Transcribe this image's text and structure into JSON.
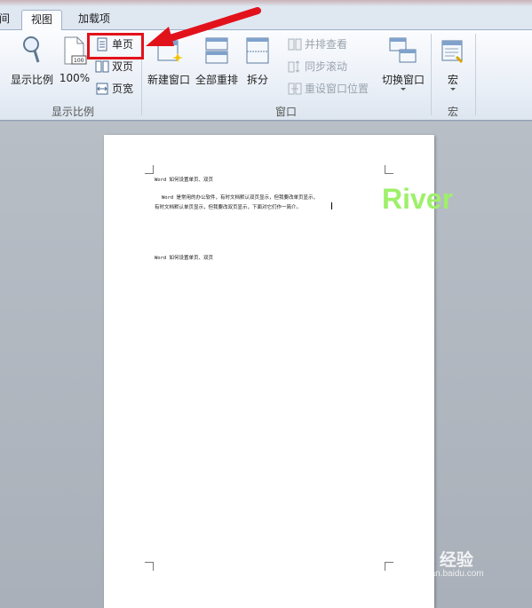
{
  "tabs": {
    "partial": "间",
    "view": "视图",
    "addins": "加载项"
  },
  "zoom_group": {
    "zoom_label": "显示比例",
    "hundred_label": "100%",
    "one_page_label": "单页",
    "two_pages_label": "双页",
    "page_width_label": "页宽",
    "group_label": "显示比例"
  },
  "window_group": {
    "new_window_label": "新建窗口",
    "arrange_all_label": "全部重排",
    "split_label": "拆分",
    "side_by_side_label": "并排查看",
    "sync_scroll_label": "同步滚动",
    "reset_position_label": "重设窗口位置",
    "switch_windows_label": "切换窗口",
    "group_label": "窗口"
  },
  "macro_group": {
    "macros_label": "宏",
    "group_label": "宏"
  },
  "document": {
    "heading1": "Word 如何设置单页、双页",
    "para_line1": "Word 是常用的办公软件，有时文档默认双页显示，但我要改单页显示，",
    "para_line2": "有时文档默认单页显示，但我要改双页显示，下面对它们作一简介。",
    "heading2": "Word 如何设置单页、双页"
  },
  "watermark": "River",
  "baidu": {
    "logo_text": "Bai 经验",
    "url": "jingyan.baidu.com"
  },
  "colors": {
    "highlight": "#e2121b",
    "arrow": "#e2121b",
    "watermark": "#9ef06a"
  }
}
